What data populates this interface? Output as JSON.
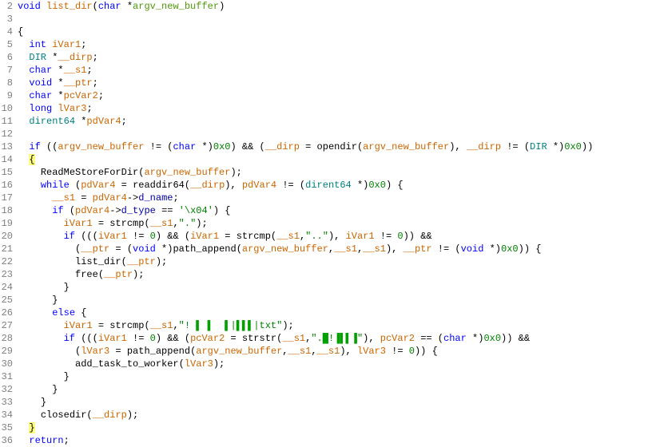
{
  "gutter": {
    "start": 2,
    "end": 36
  },
  "lines": [
    {
      "n": 2,
      "indent": 0,
      "tokens": [
        [
          "kw",
          "void"
        ],
        [
          "sp",
          " "
        ],
        [
          "id1",
          "list_dir"
        ],
        [
          "p",
          "("
        ],
        [
          "kw",
          "char"
        ],
        [
          "sp",
          " *"
        ],
        [
          "pname",
          "argv_new_buffer"
        ],
        [
          "p",
          ")"
        ]
      ]
    },
    {
      "n": 3,
      "indent": 0,
      "tokens": []
    },
    {
      "n": 4,
      "indent": 0,
      "tokens": [
        [
          "p",
          "{"
        ]
      ]
    },
    {
      "n": 5,
      "indent": 1,
      "tokens": [
        [
          "kw",
          "int"
        ],
        [
          "sp",
          " "
        ],
        [
          "id1",
          "iVar1"
        ],
        [
          "p",
          ";"
        ]
      ]
    },
    {
      "n": 6,
      "indent": 1,
      "tokens": [
        [
          "type",
          "DIR"
        ],
        [
          "sp",
          " *"
        ],
        [
          "id1",
          "__dirp"
        ],
        [
          "p",
          ";"
        ]
      ]
    },
    {
      "n": 7,
      "indent": 1,
      "tokens": [
        [
          "kw",
          "char"
        ],
        [
          "sp",
          " *"
        ],
        [
          "id1",
          "__s1"
        ],
        [
          "p",
          ";"
        ]
      ]
    },
    {
      "n": 8,
      "indent": 1,
      "tokens": [
        [
          "kw",
          "void"
        ],
        [
          "sp",
          " *"
        ],
        [
          "id1",
          "__ptr"
        ],
        [
          "p",
          ";"
        ]
      ]
    },
    {
      "n": 9,
      "indent": 1,
      "tokens": [
        [
          "kw",
          "char"
        ],
        [
          "sp",
          " *"
        ],
        [
          "id1",
          "pcVar2"
        ],
        [
          "p",
          ";"
        ]
      ]
    },
    {
      "n": 10,
      "indent": 1,
      "tokens": [
        [
          "kw",
          "long"
        ],
        [
          "sp",
          " "
        ],
        [
          "id1",
          "lVar3"
        ],
        [
          "p",
          ";"
        ]
      ]
    },
    {
      "n": 11,
      "indent": 1,
      "tokens": [
        [
          "type",
          "dirent64"
        ],
        [
          "sp",
          " *"
        ],
        [
          "id1",
          "pdVar4"
        ],
        [
          "p",
          ";"
        ]
      ]
    },
    {
      "n": 12,
      "indent": 1,
      "tokens": []
    },
    {
      "n": 13,
      "indent": 1,
      "tokens": [
        [
          "kw",
          "if"
        ],
        [
          "sp",
          " (("
        ],
        [
          "id1",
          "argv_new_buffer"
        ],
        [
          "sp",
          " != ("
        ],
        [
          "kw",
          "char"
        ],
        [
          "sp",
          " *)"
        ],
        [
          "num",
          "0x0"
        ],
        [
          "p",
          ") && ("
        ],
        [
          "id1",
          "__dirp"
        ],
        [
          "sp",
          " = "
        ],
        [
          "func",
          "opendir"
        ],
        [
          "p",
          "("
        ],
        [
          "id1",
          "argv_new_buffer"
        ],
        [
          "p",
          "), "
        ],
        [
          "id1",
          "__dirp"
        ],
        [
          "sp",
          " != ("
        ],
        [
          "type",
          "DIR"
        ],
        [
          "sp",
          " *)"
        ],
        [
          "num",
          "0x0"
        ],
        [
          "p",
          "))"
        ]
      ]
    },
    {
      "n": 14,
      "indent": 1,
      "tokens": [
        [
          "hlopen",
          "{"
        ]
      ]
    },
    {
      "n": 15,
      "indent": 2,
      "tokens": [
        [
          "func",
          "ReadMeStoreForDir"
        ],
        [
          "p",
          "("
        ],
        [
          "id1",
          "argv_new_buffer"
        ],
        [
          "p",
          ");"
        ]
      ]
    },
    {
      "n": 16,
      "indent": 2,
      "tokens": [
        [
          "kw",
          "while"
        ],
        [
          "sp",
          " ("
        ],
        [
          "id1",
          "pdVar4"
        ],
        [
          "sp",
          " = "
        ],
        [
          "func",
          "readdir64"
        ],
        [
          "p",
          "("
        ],
        [
          "id1",
          "__dirp"
        ],
        [
          "p",
          "), "
        ],
        [
          "id1",
          "pdVar4"
        ],
        [
          "sp",
          " != ("
        ],
        [
          "type",
          "dirent64"
        ],
        [
          "sp",
          " *)"
        ],
        [
          "num",
          "0x0"
        ],
        [
          "p",
          ") {"
        ]
      ]
    },
    {
      "n": 17,
      "indent": 3,
      "tokens": [
        [
          "id1",
          "__s1"
        ],
        [
          "sp",
          " = "
        ],
        [
          "id1",
          "pdVar4"
        ],
        [
          "p",
          "->"
        ],
        [
          "field",
          "d_name"
        ],
        [
          "p",
          ";"
        ]
      ]
    },
    {
      "n": 18,
      "indent": 3,
      "tokens": [
        [
          "kw",
          "if"
        ],
        [
          "sp",
          " ("
        ],
        [
          "id1",
          "pdVar4"
        ],
        [
          "p",
          "->"
        ],
        [
          "field",
          "d_type"
        ],
        [
          "sp",
          " == "
        ],
        [
          "str",
          "'\\x04'"
        ],
        [
          "p",
          ") {"
        ]
      ]
    },
    {
      "n": 19,
      "indent": 4,
      "tokens": [
        [
          "id1",
          "iVar1"
        ],
        [
          "sp",
          " = "
        ],
        [
          "func",
          "strcmp"
        ],
        [
          "p",
          "("
        ],
        [
          "id1",
          "__s1"
        ],
        [
          "p",
          ","
        ],
        [
          "str",
          "\".\""
        ],
        [
          "p",
          ");"
        ]
      ]
    },
    {
      "n": 20,
      "indent": 4,
      "tokens": [
        [
          "kw",
          "if"
        ],
        [
          "sp",
          " ((("
        ],
        [
          "id1",
          "iVar1"
        ],
        [
          "sp",
          " != "
        ],
        [
          "num",
          "0"
        ],
        [
          "p",
          ") && ("
        ],
        [
          "id1",
          "iVar1"
        ],
        [
          "sp",
          " = "
        ],
        [
          "func",
          "strcmp"
        ],
        [
          "p",
          "("
        ],
        [
          "id1",
          "__s1"
        ],
        [
          "p",
          ","
        ],
        [
          "str",
          "\"..\""
        ],
        [
          "p",
          "), "
        ],
        [
          "id1",
          "iVar1"
        ],
        [
          "sp",
          " != "
        ],
        [
          "num",
          "0"
        ],
        [
          "p",
          ")) &&"
        ]
      ]
    },
    {
      "n": 21,
      "indent": 5,
      "tokens": [
        [
          "p",
          "("
        ],
        [
          "id1",
          "__ptr"
        ],
        [
          "sp",
          " = ("
        ],
        [
          "kw",
          "void"
        ],
        [
          "sp",
          " *)"
        ],
        [
          "func",
          "path_append"
        ],
        [
          "p",
          "("
        ],
        [
          "id1",
          "argv_new_buffer"
        ],
        [
          "p",
          ","
        ],
        [
          "id1",
          "__s1"
        ],
        [
          "p",
          ","
        ],
        [
          "id1",
          "__s1"
        ],
        [
          "p",
          "), "
        ],
        [
          "id1",
          "__ptr"
        ],
        [
          "sp",
          " != ("
        ],
        [
          "kw",
          "void"
        ],
        [
          "sp",
          " *)"
        ],
        [
          "num",
          "0x0"
        ],
        [
          "p",
          ")) {"
        ]
      ]
    },
    {
      "n": 22,
      "indent": 5,
      "tokens": [
        [
          "func",
          "list_dir"
        ],
        [
          "p",
          "("
        ],
        [
          "id1",
          "__ptr"
        ],
        [
          "p",
          ");"
        ]
      ]
    },
    {
      "n": 23,
      "indent": 5,
      "tokens": [
        [
          "func",
          "free"
        ],
        [
          "p",
          "("
        ],
        [
          "id1",
          "__ptr"
        ],
        [
          "p",
          ");"
        ]
      ]
    },
    {
      "n": 24,
      "indent": 4,
      "tokens": [
        [
          "p",
          "}"
        ]
      ]
    },
    {
      "n": 25,
      "indent": 3,
      "tokens": [
        [
          "p",
          "}"
        ]
      ]
    },
    {
      "n": 26,
      "indent": 3,
      "tokens": [
        [
          "kw",
          "else"
        ],
        [
          "sp",
          " {"
        ]
      ]
    },
    {
      "n": 27,
      "indent": 4,
      "tokens": [
        [
          "id1",
          "iVar1"
        ],
        [
          "sp",
          " = "
        ],
        [
          "func",
          "strcmp"
        ],
        [
          "p",
          "("
        ],
        [
          "id1",
          "__s1"
        ],
        [
          "p",
          ","
        ],
        [
          "str",
          "\"! "
        ],
        [
          "glyph",
          "▌ ▌"
        ],
        [
          "str",
          "  "
        ],
        [
          "glyph",
          "▌"
        ],
        [
          "str",
          "|"
        ],
        [
          "glyph",
          "▌▌▌"
        ],
        [
          "str",
          "|txt\""
        ],
        [
          "p",
          ");"
        ]
      ]
    },
    {
      "n": 28,
      "indent": 4,
      "tokens": [
        [
          "kw",
          "if"
        ],
        [
          "sp",
          " ((("
        ],
        [
          "id1",
          "iVar1"
        ],
        [
          "sp",
          " != "
        ],
        [
          "num",
          "0"
        ],
        [
          "p",
          ") && ("
        ],
        [
          "id1",
          "pcVar2"
        ],
        [
          "sp",
          " = "
        ],
        [
          "func",
          "strstr"
        ],
        [
          "p",
          "("
        ],
        [
          "id1",
          "__s1"
        ],
        [
          "p",
          ","
        ],
        [
          "str",
          "\"."
        ],
        [
          "glyph",
          "█"
        ],
        [
          "str",
          "!"
        ],
        [
          "glyph",
          "▐▌▌▐"
        ],
        [
          "str",
          "\""
        ],
        [
          "p",
          "), "
        ],
        [
          "id1",
          "pcVar2"
        ],
        [
          "sp",
          " == ("
        ],
        [
          "kw",
          "char"
        ],
        [
          "sp",
          " *)"
        ],
        [
          "num",
          "0x0"
        ],
        [
          "p",
          ")) &&"
        ]
      ]
    },
    {
      "n": 29,
      "indent": 5,
      "tokens": [
        [
          "p",
          "("
        ],
        [
          "id1",
          "lVar3"
        ],
        [
          "sp",
          " = "
        ],
        [
          "func",
          "path_append"
        ],
        [
          "p",
          "("
        ],
        [
          "id1",
          "argv_new_buffer"
        ],
        [
          "p",
          ","
        ],
        [
          "id1",
          "__s1"
        ],
        [
          "p",
          ","
        ],
        [
          "id1",
          "__s1"
        ],
        [
          "p",
          "), "
        ],
        [
          "id1",
          "lVar3"
        ],
        [
          "sp",
          " != "
        ],
        [
          "num",
          "0"
        ],
        [
          "p",
          ")) {"
        ]
      ]
    },
    {
      "n": 30,
      "indent": 5,
      "tokens": [
        [
          "func",
          "add_task_to_worker"
        ],
        [
          "p",
          "("
        ],
        [
          "id1",
          "lVar3"
        ],
        [
          "p",
          ");"
        ]
      ]
    },
    {
      "n": 31,
      "indent": 4,
      "tokens": [
        [
          "p",
          "}"
        ]
      ]
    },
    {
      "n": 32,
      "indent": 3,
      "tokens": [
        [
          "p",
          "}"
        ]
      ]
    },
    {
      "n": 33,
      "indent": 2,
      "tokens": [
        [
          "p",
          "}"
        ]
      ]
    },
    {
      "n": 34,
      "indent": 2,
      "tokens": [
        [
          "func",
          "closedir"
        ],
        [
          "p",
          "("
        ],
        [
          "id1",
          "__dirp"
        ],
        [
          "p",
          ");"
        ]
      ]
    },
    {
      "n": 35,
      "indent": 1,
      "tokens": [
        [
          "hlclose",
          "}"
        ]
      ]
    },
    {
      "n": 36,
      "indent": 1,
      "tokens": [
        [
          "kw",
          "return"
        ],
        [
          "p",
          ";"
        ]
      ]
    }
  ],
  "indent_unit": "  "
}
